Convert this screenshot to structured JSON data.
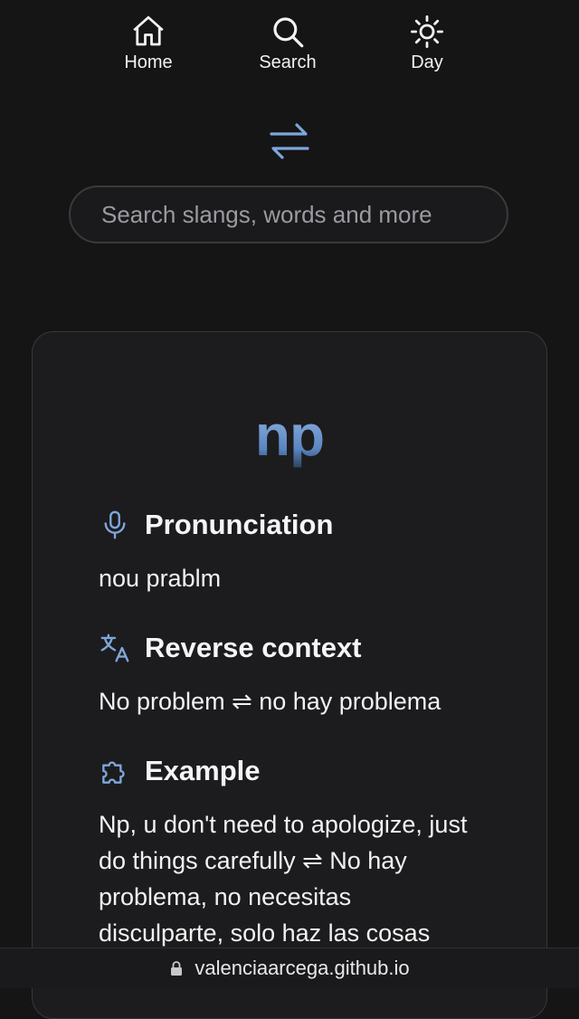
{
  "nav": {
    "home_label": "Home",
    "search_label": "Search",
    "day_label": "Day"
  },
  "search": {
    "placeholder": "Search slangs, words and more"
  },
  "entry": {
    "word": "np",
    "pronunciation_heading": "Pronunciation",
    "pronunciation": "nou prablm",
    "reverse_heading": "Reverse context",
    "reverse": "No problem ⇌ no hay problema",
    "example_heading": "Example",
    "example": "Np, u don't need to apologize, just do things carefully ⇌ No hay problema, no necesitas disculparte, solo haz las cosas"
  },
  "browser": {
    "url": "valenciaarcega.github.io"
  },
  "colors": {
    "background": "#151516",
    "card": "#1c1c1e",
    "accent": "#7fa6dc",
    "text": "#f2f2f2"
  }
}
